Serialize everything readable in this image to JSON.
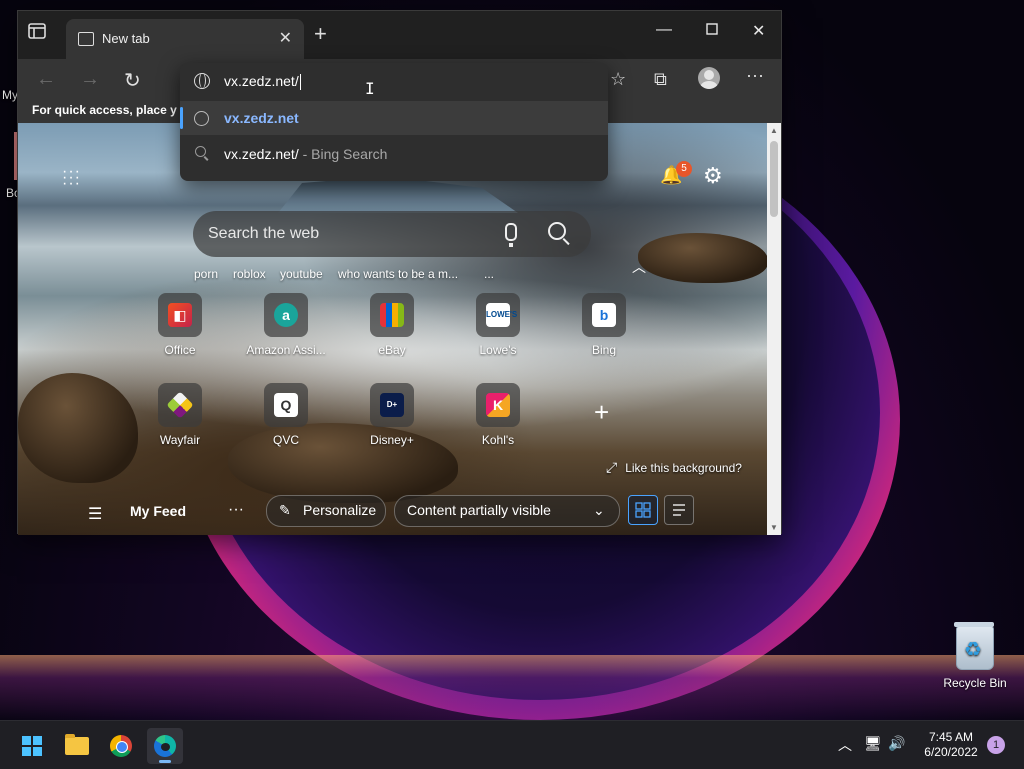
{
  "desktop": {
    "fragments": {
      "my": "My",
      "bo": "Bo"
    },
    "recycle_bin_label": "Recycle Bin"
  },
  "browser": {
    "tab_title": "New tab",
    "favorites_bar_text": "For quick access, place y",
    "address": {
      "value": "vx.zedz.net/",
      "suggestions": [
        {
          "icon": "globe-icon",
          "text": "vx.zedz.net",
          "selected": true
        },
        {
          "icon": "search-icon",
          "text": "vx.zedz.net/",
          "suffix": " - Bing Search",
          "selected": false
        }
      ]
    },
    "notifications_count": "5",
    "search": {
      "placeholder": "Search the web"
    },
    "trending": [
      "porn",
      "roblox",
      "youtube",
      "who wants to be a m...",
      "..."
    ],
    "tiles_row1": [
      {
        "label": "Office",
        "icon": "office-icon"
      },
      {
        "label": "Amazon Assi...",
        "icon": "amazon-icon"
      },
      {
        "label": "eBay",
        "icon": "ebay-icon"
      },
      {
        "label": "Lowe's",
        "icon": "lowes-icon"
      },
      {
        "label": "Bing",
        "icon": "bing-icon"
      }
    ],
    "tiles_row2": [
      {
        "label": "Wayfair",
        "icon": "wayfair-icon"
      },
      {
        "label": "QVC",
        "icon": "qvc-icon"
      },
      {
        "label": "Disney+",
        "icon": "disney-icon"
      },
      {
        "label": "Kohl's",
        "icon": "kohls-icon"
      }
    ],
    "background_prompt": "Like this background?",
    "feed": {
      "title": "My Feed",
      "personalize": "Personalize",
      "visibility": "Content partially visible"
    }
  },
  "taskbar": {
    "time": "7:45 AM",
    "date": "6/20/2022",
    "notification_count": "1"
  },
  "colors": {
    "accent": "#4aa3ff",
    "badge": "#e8562a",
    "taskbar": "#1f1f24"
  }
}
